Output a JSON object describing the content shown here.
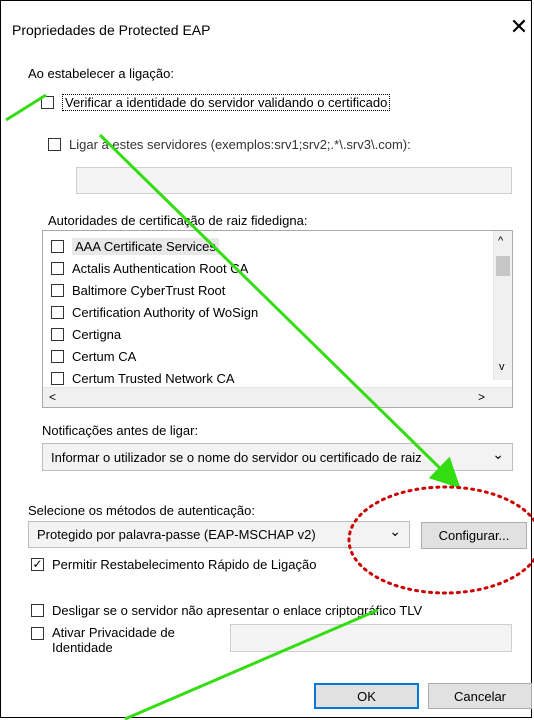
{
  "window": {
    "title": "Propriedades de Protected EAP",
    "close_glyph": "✕"
  },
  "connect_section": {
    "label": "Ao estabelecer a ligação:",
    "verify_label": "Verificar a identidade do servidor validando o certificado",
    "verify_checked": false,
    "connect_servers_label": "Ligar a estes servidores (exemplos:srv1;srv2;.*\\.srv3\\.com):",
    "connect_servers_checked": false,
    "servers_value": ""
  },
  "trusted_roots": {
    "label": "Autoridades de certificação de raiz fidedigna:",
    "items": [
      {
        "label": "AAA Certificate Services",
        "checked": false
      },
      {
        "label": "Actalis Authentication Root CA",
        "checked": false
      },
      {
        "label": "Baltimore CyberTrust Root",
        "checked": false
      },
      {
        "label": "Certification Authority of WoSign",
        "checked": false
      },
      {
        "label": "Certigna",
        "checked": false
      },
      {
        "label": "Certum CA",
        "checked": false
      },
      {
        "label": "Certum Trusted Network CA",
        "checked": false
      }
    ]
  },
  "notifications": {
    "label": "Notificações antes de ligar:",
    "selected": "Informar o utilizador se o nome do servidor ou certificado de raiz"
  },
  "auth": {
    "label": "Selecione os métodos de autenticação:",
    "selected": "Protegido por palavra-passe (EAP-MSCHAP v2)",
    "configure_label": "Configurar...",
    "fast_reconnect_label": "Permitir Restabelecimento Rápido de Ligação",
    "fast_reconnect_checked": true,
    "disconnect_tlv_label": "Desligar se o servidor não apresentar o enlace criptográfico TLV",
    "disconnect_tlv_checked": false,
    "privacy_label_line1": "Ativar Privacidade de",
    "privacy_label_line2": "Identidade",
    "privacy_checked": false,
    "privacy_value": ""
  },
  "buttons": {
    "ok": "OK",
    "cancel": "Cancelar"
  },
  "icons": {
    "chevron_down": "⌄",
    "scroll_up": "^",
    "scroll_down": "v",
    "scroll_left": "<",
    "scroll_right": ">"
  },
  "annotation_colors": {
    "arrow": "#33dd11",
    "ellipse": "#cc0000"
  }
}
